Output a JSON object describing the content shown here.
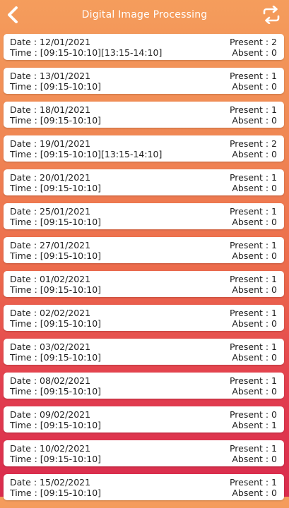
{
  "header": {
    "title": "Digital Image Processing",
    "back_icon": "chevron-left-icon",
    "refresh_icon": "refresh-icon"
  },
  "labels": {
    "date": "Date : ",
    "time": "Time : ",
    "present": "Present : ",
    "absent": "Absent : "
  },
  "records": [
    {
      "date": "12/01/2021",
      "time": "[09:15-10:10][13:15-14:10]",
      "present": "2",
      "absent": "0"
    },
    {
      "date": "13/01/2021",
      "time": "[09:15-10:10]",
      "present": "1",
      "absent": "0"
    },
    {
      "date": "18/01/2021",
      "time": "[09:15-10:10]",
      "present": "1",
      "absent": "0"
    },
    {
      "date": "19/01/2021",
      "time": "[09:15-10:10][13:15-14:10]",
      "present": "2",
      "absent": "0"
    },
    {
      "date": "20/01/2021",
      "time": "[09:15-10:10]",
      "present": "1",
      "absent": "0"
    },
    {
      "date": "25/01/2021",
      "time": "[09:15-10:10]",
      "present": "1",
      "absent": "0"
    },
    {
      "date": "27/01/2021",
      "time": "[09:15-10:10]",
      "present": "1",
      "absent": "0"
    },
    {
      "date": "01/02/2021",
      "time": "[09:15-10:10]",
      "present": "1",
      "absent": "0"
    },
    {
      "date": "02/02/2021",
      "time": "[09:15-10:10]",
      "present": "1",
      "absent": "0"
    },
    {
      "date": "03/02/2021",
      "time": "[09:15-10:10]",
      "present": "1",
      "absent": "0"
    },
    {
      "date": "08/02/2021",
      "time": "[09:15-10:10]",
      "present": "1",
      "absent": "0"
    },
    {
      "date": "09/02/2021",
      "time": "[09:15-10:10]",
      "present": "0",
      "absent": "1"
    },
    {
      "date": "10/02/2021",
      "time": "[09:15-10:10]",
      "present": "1",
      "absent": "0"
    },
    {
      "date": "15/02/2021",
      "time": "[09:15-10:10]",
      "present": "1",
      "absent": "0"
    }
  ]
}
